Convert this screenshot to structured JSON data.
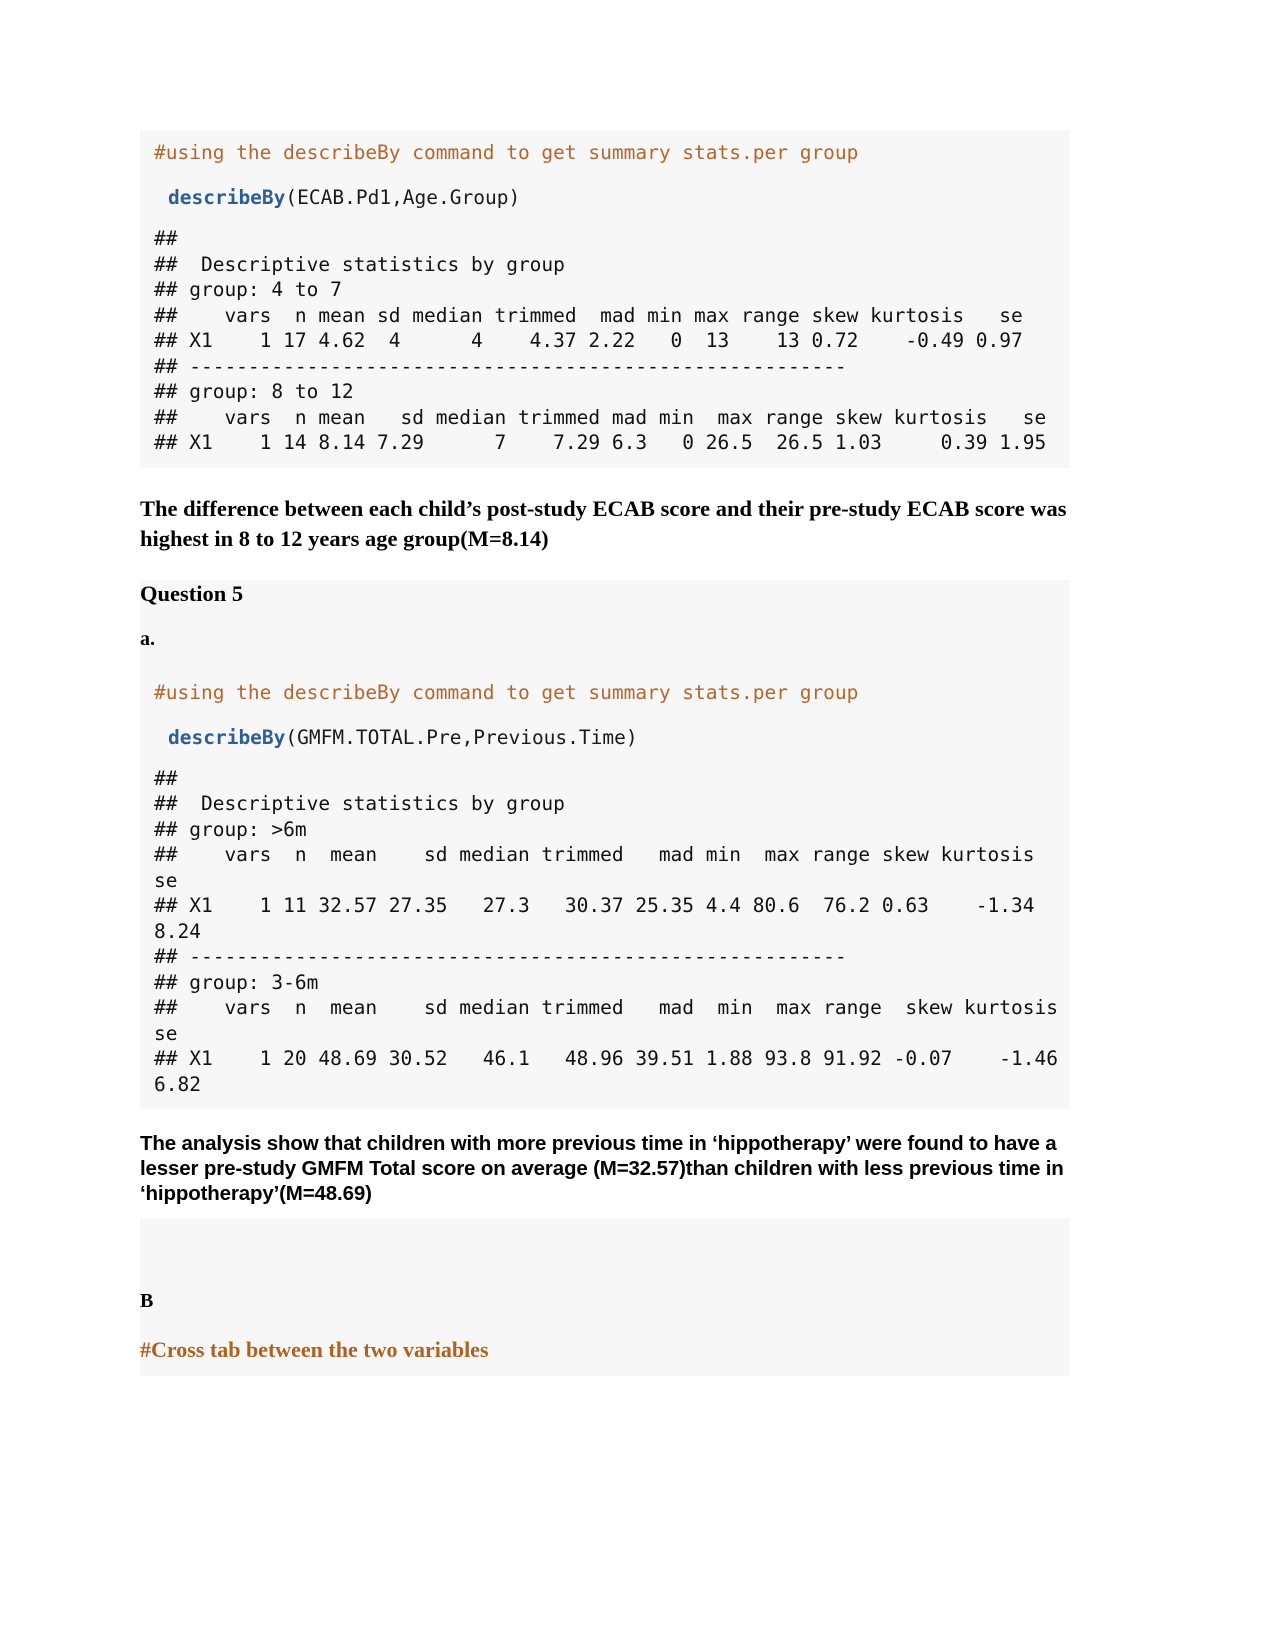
{
  "document": {
    "type": "knitted-r-markdown-report",
    "page_background": "#ffffff",
    "code_background": "#f7f7f7",
    "comment_color": "#b8642a",
    "function_color": "#2e5f94"
  },
  "block1": {
    "comment": "#using the describeBy command to get summary stats.per group",
    "call_function": "describeBy",
    "call_args": "(ECAB.Pd1,Age.Group)",
    "output_lines": [
      "## ",
      "##  Descriptive statistics by group ",
      "## group: 4 to 7",
      "##    vars  n mean sd median trimmed  mad min max range skew kurtosis   se",
      "## X1    1 17 4.62  4      4    4.37 2.22   0  13    13 0.72    -0.49 0.97",
      "## -------------------------------------------------------- ",
      "## group: 8 to 12",
      "##    vars  n mean   sd median trimmed mad min  max range skew kurtosis   se",
      "## X1    1 14 8.14 7.29      7    7.29 6.3   0 26.5  26.5 1.03     0.39 1.95"
    ]
  },
  "paragraph1": "The difference between each child’s post-study ECAB score and their pre-study ECAB score was highest in  8 to 12 years age group(M=8.14)",
  "question5": {
    "heading": "Question 5",
    "sublabel_a": "a.",
    "sublabel_b": "B"
  },
  "block2": {
    "comment": "#using the describeBy command to get summary stats.per group",
    "call_function": "describeBy",
    "call_args": "(GMFM.TOTAL.Pre,Previous.Time)",
    "output_lines": [
      "## ",
      "##  Descriptive statistics by group ",
      "## group: >6m",
      "##    vars  n  mean    sd median trimmed   mad min  max range skew kurtosis   se",
      "## X1    1 11 32.57 27.35   27.3   30.37 25.35 4.4 80.6  76.2 0.63    -1.34 8.24",
      "## -------------------------------------------------------- ",
      "## group: 3-6m",
      "##    vars  n  mean    sd median trimmed   mad  min  max range  skew kurtosis   se",
      "## X1    1 20 48.69 30.52   46.1   48.96 39.51 1.88 93.8 91.92 -0.07    -1.46 6.82"
    ]
  },
  "paragraph2": "The analysis show that children with more previous time in ‘hippotherapy’ were found to have a lesser pre-study GMFM Total score on average (M=32.57)than children with less previous time in ‘hippotherapy’(M=48.69)",
  "crosstab_comment": "#Cross tab between the two variables",
  "chart_data": {
    "type": "table",
    "title": "Descriptive statistics by group (describeBy output)",
    "tables": [
      {
        "name": "ECAB.Pd1 by Age.Group",
        "columns": [
          "",
          "vars",
          "n",
          "mean",
          "sd",
          "median",
          "trimmed",
          "mad",
          "min",
          "max",
          "range",
          "skew",
          "kurtosis",
          "se"
        ],
        "groups": [
          {
            "group": "4 to 7",
            "rows": [
              [
                "X1",
                1,
                17,
                4.62,
                4,
                4,
                4.37,
                2.22,
                0,
                13,
                13,
                0.72,
                -0.49,
                0.97
              ]
            ]
          },
          {
            "group": "8 to 12",
            "rows": [
              [
                "X1",
                1,
                14,
                8.14,
                7.29,
                7,
                7.29,
                6.3,
                0,
                26.5,
                26.5,
                1.03,
                0.39,
                1.95
              ]
            ]
          }
        ]
      },
      {
        "name": "GMFM.TOTAL.Pre by Previous.Time",
        "columns": [
          "",
          "vars",
          "n",
          "mean",
          "sd",
          "median",
          "trimmed",
          "mad",
          "min",
          "max",
          "range",
          "skew",
          "kurtosis",
          "se"
        ],
        "groups": [
          {
            "group": ">6m",
            "rows": [
              [
                "X1",
                1,
                11,
                32.57,
                27.35,
                27.3,
                30.37,
                25.35,
                4.4,
                80.6,
                76.2,
                0.63,
                -1.34,
                8.24
              ]
            ]
          },
          {
            "group": "3-6m",
            "rows": [
              [
                "X1",
                1,
                20,
                48.69,
                30.52,
                46.1,
                48.96,
                39.51,
                1.88,
                93.8,
                91.92,
                -0.07,
                -1.46,
                6.82
              ]
            ]
          }
        ]
      }
    ]
  }
}
